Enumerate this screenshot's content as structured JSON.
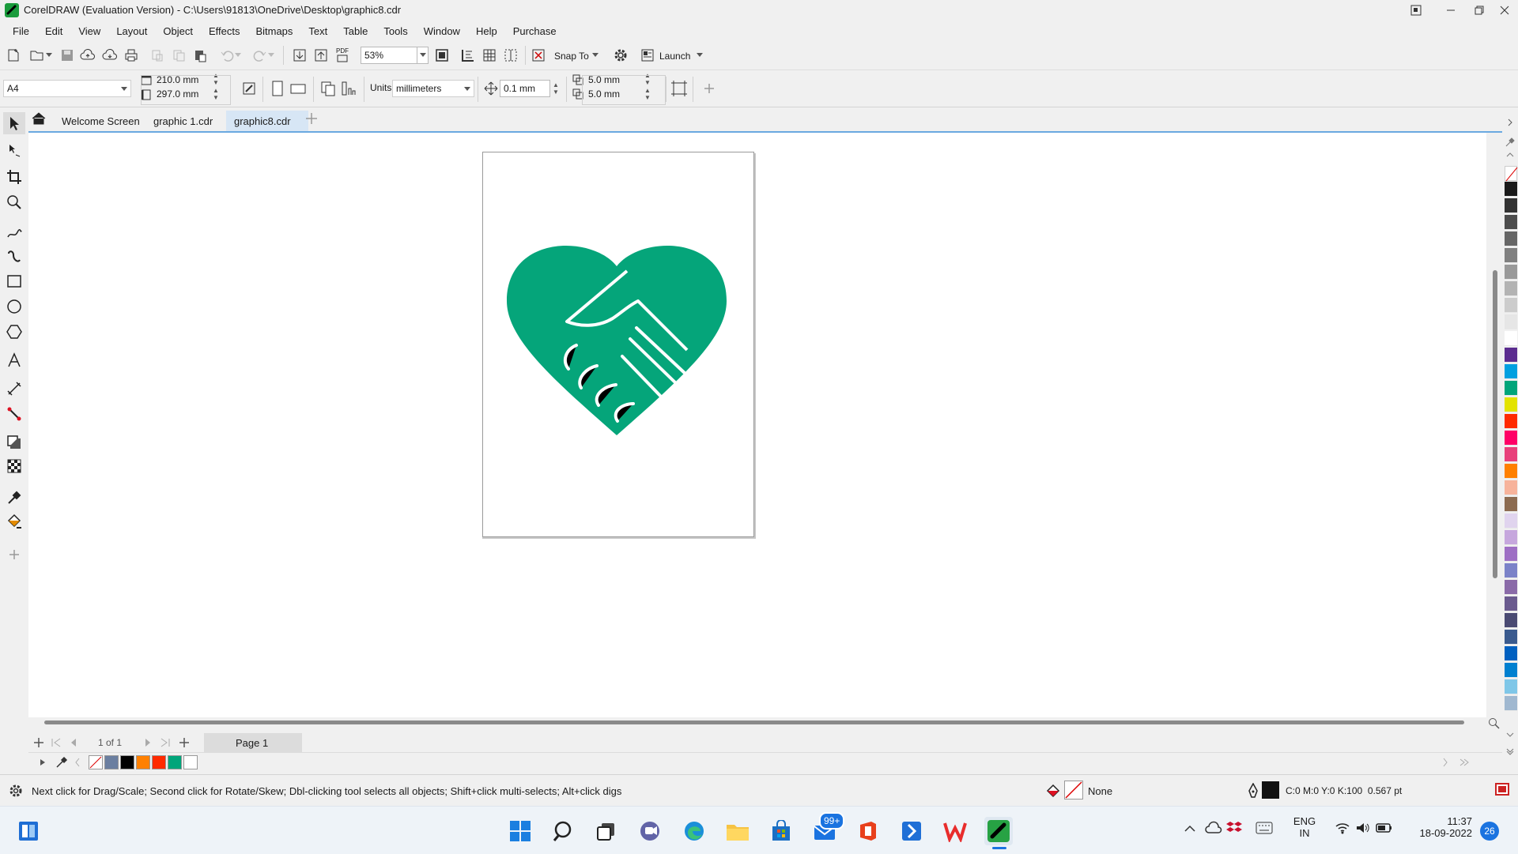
{
  "window": {
    "title": "CorelDRAW (Evaluation Version) - C:\\Users\\91813\\OneDrive\\Desktop\\graphic8.cdr"
  },
  "menu": {
    "items": [
      "File",
      "Edit",
      "View",
      "Layout",
      "Object",
      "Effects",
      "Bitmaps",
      "Text",
      "Table",
      "Tools",
      "Window",
      "Help",
      "Purchase"
    ]
  },
  "toolbar": {
    "zoom_value": "53%",
    "snap_label": "Snap To",
    "launch_label": "Launch",
    "pdf_label": "PDF"
  },
  "property_bar": {
    "page_size": "A4",
    "width": "210.0 mm",
    "height": "297.0 mm",
    "units_label": "Units:",
    "units_value": "millimeters",
    "nudge": "0.1 mm",
    "dup_x": "5.0 mm",
    "dup_y": "5.0 mm"
  },
  "tabs": {
    "items": [
      "Welcome Screen",
      "graphic 1.cdr",
      "graphic8.cdr"
    ],
    "active": "graphic8.cdr"
  },
  "artwork": {
    "name": "handshake-heart",
    "color": "#05a57a"
  },
  "page_nav": {
    "indicator": "1 of 1",
    "page_tab": "Page 1"
  },
  "document_palette": {
    "colors": [
      "#6b7fa0",
      "#000000",
      "#ff8000",
      "#ff2a00",
      "#00a57a",
      "#ffffff"
    ]
  },
  "color_palette": {
    "colors": [
      "#1a1a1a",
      "#333333",
      "#4d4d4d",
      "#666666",
      "#808080",
      "#999999",
      "#b3b3b3",
      "#cccccc",
      "#e6e6e6",
      "#ffffff",
      "#5b2c8f",
      "#00a0e0",
      "#00a57a",
      "#e3e300",
      "#ff2a00",
      "#ff0066",
      "#e8407a",
      "#ff8000",
      "#f7b39b",
      "#8c6b50",
      "#e0d4ee",
      "#c6a7dd",
      "#9e6fc4",
      "#7b82c8",
      "#8a6aa8",
      "#6a5a8e",
      "#4a4a72",
      "#3a5a8e",
      "#0060c0",
      "#0080d0",
      "#7fc7e8",
      "#a0b8d0"
    ]
  },
  "status": {
    "message": "Next click for Drag/Scale; Second click for Rotate/Skew; Dbl-clicking tool selects all objects; Shift+click multi-selects; Alt+click digs",
    "fill_label": "None",
    "outline_info": "C:0 M:0 Y:0 K:100  0.567 pt"
  },
  "taskbar": {
    "language": "ENG",
    "region": "IN",
    "time": "11:37",
    "date": "18-09-2022",
    "mail_badge": "99+",
    "notification_count": "26"
  }
}
